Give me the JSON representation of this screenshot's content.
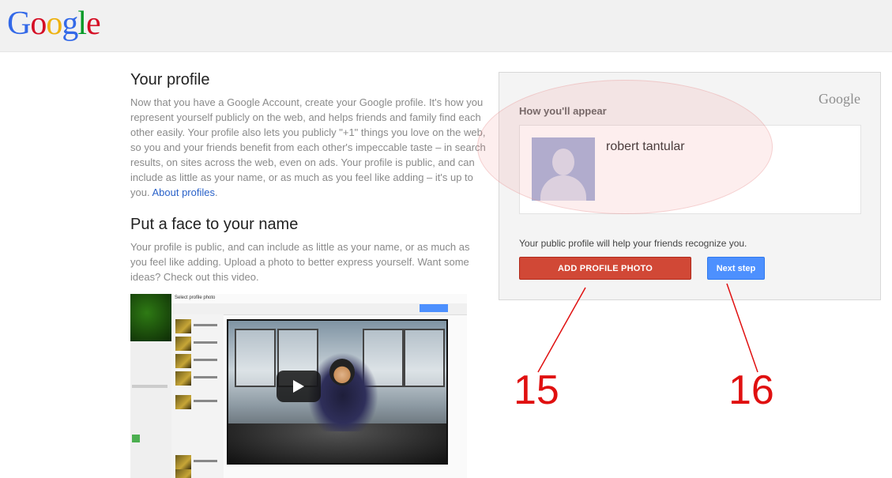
{
  "header": {
    "logo_letters": [
      "G",
      "o",
      "o",
      "g",
      "l",
      "e"
    ]
  },
  "left": {
    "profile_title": "Your profile",
    "profile_body": "Now that you have a Google Account, create your Google profile. It's how you represent yourself publicly on the web, and helps friends and family find each other easily. Your profile also lets you publicly \"+1\" things you love on the web, so you and your friends benefit from each other's impeccable taste – in search results, on sites across the web, even on ads. Your profile is public, and can include as little as your name, or as much as you feel like adding – it's up to you.",
    "about_link": "About profiles",
    "face_title": "Put a face to your name",
    "face_body": "Your profile is public, and can include as little as your name, or as much as you feel like adding. Upload a photo to better express yourself. Want some ideas? Check out this video.",
    "video_heading": "Select profile photo"
  },
  "card": {
    "logo": "Google",
    "appear_label": "How you'll appear",
    "user_name": "robert tantular",
    "help_text": "Your public profile will help your friends recognize you.",
    "add_photo_label": "ADD PROFILE PHOTO",
    "next_label": "Next step"
  },
  "annotations": {
    "label_1": "15",
    "label_2": "16",
    "color": "#e01010"
  },
  "colors": {
    "add_button": "#d14836",
    "next_button": "#4d90fe",
    "link": "#2a62c9"
  }
}
